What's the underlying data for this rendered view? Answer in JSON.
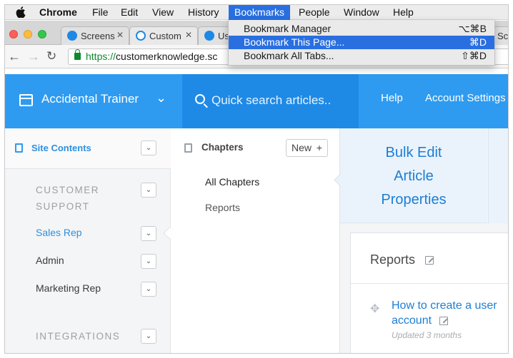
{
  "menubar": {
    "app_name": "Chrome",
    "items": [
      "File",
      "Edit",
      "View",
      "History",
      "Bookmarks",
      "People",
      "Window",
      "Help"
    ],
    "active": "Bookmarks"
  },
  "bookmarks_menu": {
    "items": [
      {
        "label": "Bookmark Manager",
        "shortcut": "⌥⌘B",
        "highlighted": false
      },
      {
        "label": "Bookmark This Page...",
        "shortcut": "⌘D",
        "highlighted": true
      },
      {
        "label": "Bookmark All Tabs...",
        "shortcut": "⇧⌘D",
        "highlighted": false
      }
    ]
  },
  "tabs": [
    {
      "title": "Screens",
      "icon": "screensteps-icon"
    },
    {
      "title": "Custom",
      "icon": "customer-knowledge-icon"
    },
    {
      "title": "Us",
      "icon": "screensteps-icon"
    },
    {
      "title": "Scr",
      "icon": "screensteps-icon"
    }
  ],
  "address_bar": {
    "scheme": "https://",
    "host": "customerknowledge.sc"
  },
  "header": {
    "site_name": "Accidental Trainer",
    "search_placeholder": "Quick search articles..",
    "links": [
      "Help",
      "Account Settings"
    ]
  },
  "sidebar": {
    "title": "Site Contents",
    "sections": [
      {
        "label": "CUSTOMER SUPPORT",
        "type": "category"
      },
      {
        "label": "Sales Rep",
        "type": "item",
        "active": true
      },
      {
        "label": "Admin",
        "type": "item"
      },
      {
        "label": "Marketing Rep",
        "type": "item"
      },
      {
        "label": "INTEGRATIONS",
        "type": "category"
      }
    ]
  },
  "chapters": {
    "title": "Chapters",
    "new_label": "New",
    "items": [
      {
        "label": "All Chapters",
        "active": true
      },
      {
        "label": "Reports",
        "active": false
      }
    ]
  },
  "main": {
    "bulk_edit_lines": [
      "Bulk Edit",
      "Article",
      "Properties"
    ],
    "card_title": "Reports",
    "article_title": "How to create a user account",
    "article_meta": "Updated 3 months"
  },
  "colors": {
    "header_blue": "#2e9bf0",
    "search_blue": "#1e8ae6",
    "link_blue": "#1c7ed6",
    "menu_highlight": "#2a6fe0"
  }
}
